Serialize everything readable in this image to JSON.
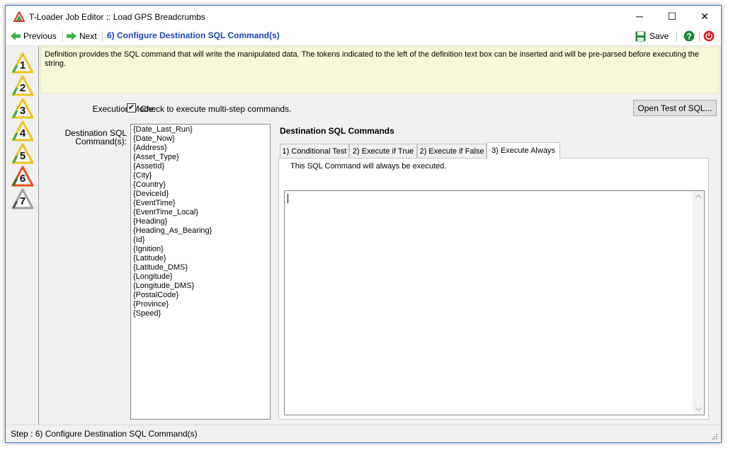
{
  "window": {
    "title": "T-Loader Job Editor :: Load GPS Breadcrumbs",
    "controls": {
      "minimize": "─",
      "maximize": "☐",
      "close": "✕"
    }
  },
  "toolbar": {
    "previous_label": "Previous",
    "next_label": "Next",
    "step_title": "6) Configure Destination SQL Command(s)",
    "save_label": "Save",
    "help_icon": "help-icon",
    "power_icon": "power-icon"
  },
  "steps": [
    {
      "number": "1",
      "color": "#f0c419"
    },
    {
      "number": "2",
      "color": "#f0c419"
    },
    {
      "number": "3",
      "color": "#f0c419"
    },
    {
      "number": "4",
      "color": "#f0c419"
    },
    {
      "number": "5",
      "color": "#f0c419"
    },
    {
      "number": "6",
      "color": "#e8501c"
    },
    {
      "number": "7",
      "color": "#a0a0a0"
    }
  ],
  "description": "Definition provides the SQL command that will write the manipulated data. The tokens indicated to the left of the definition text box can be inserted and will be pre-parsed before executing the string.",
  "execution_mode": {
    "label": "Execution Mode:",
    "checked": true,
    "check_mark": "✔",
    "checkbox_text": "Check to execute multi-step commands."
  },
  "open_test_button": "Open Test of SQL...",
  "commands_label_line1": "Destination SQL",
  "commands_label_line2": "Command(s):",
  "tokens": [
    "{Date_Last_Run}",
    "{Date_Now}",
    "{Address}",
    "{Asset_Type}",
    "{AssetId}",
    "{City}",
    "{Country}",
    "{DeviceId}",
    "{EventTime}",
    "{EventTime_Local}",
    "{Heading}",
    "{Heading_As_Bearing}",
    "{Id}",
    "{Ignition}",
    "{Latitude}",
    "{Latitude_DMS}",
    "{Longitude}",
    "{Longitude_DMS}",
    "{PostalCode}",
    "{Province}",
    "{Speed}"
  ],
  "section_title": "Destination SQL Commands",
  "tabs": [
    {
      "label": "1) Conditional Test"
    },
    {
      "label": "2) Execute if True"
    },
    {
      "label": "2) Execute if False"
    },
    {
      "label": "3) Execute Always"
    }
  ],
  "active_tab_note": "This SQL Command will always be executed.",
  "sql_text": "",
  "status": "Step : 6) Configure Destination SQL Command(s)",
  "colors": {
    "accent": "#1d45b9",
    "description_bg": "#f6f6d8",
    "window_border": "#3d7bd1"
  }
}
